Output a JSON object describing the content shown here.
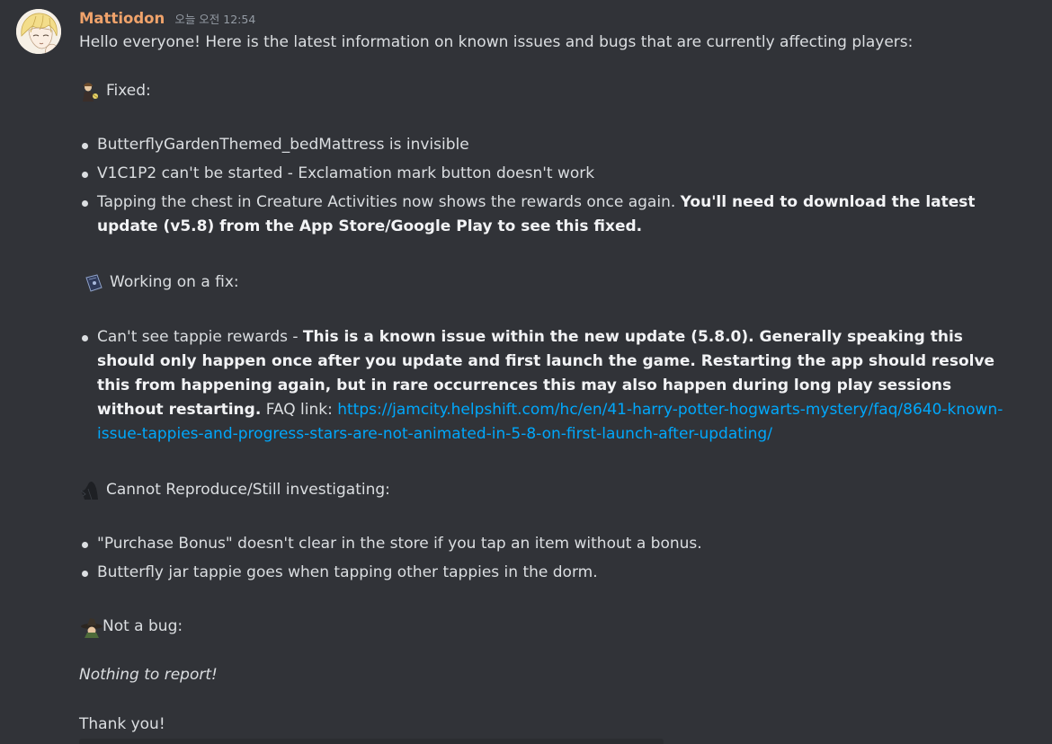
{
  "author": {
    "name": "Mattiodon",
    "timestamp": "오늘 오전 12:54"
  },
  "colors": {
    "background": "#313338",
    "username": "#f0a36b",
    "link": "#00a8fc",
    "text": "#dbdee1"
  },
  "intro": "Hello everyone! Here is the latest information on known issues and bugs that are currently affecting players:",
  "sections": {
    "fixed": {
      "icon": "wizard-emoji-icon",
      "title": "Fixed:",
      "items": [
        {
          "text": "ButterflyGardenThemed_bedMattress is invisible"
        },
        {
          "text": "V1C1P2 can't be started - Exclamation mark button doesn't work"
        },
        {
          "text": "Tapping the chest in Creature Activities now shows the rewards once again. ",
          "bold": "You'll need to download the latest update (v5.8) from the App Store/Google Play to see this fixed."
        }
      ]
    },
    "working": {
      "icon": "spellbook-emoji-icon",
      "title": "Working on a fix:",
      "items": [
        {
          "text": "Can't see tappie rewards - ",
          "bold": "This is a known issue within the new update (5.8.0). Generally speaking this should only happen once after you update and first launch the game. Restarting the app should resolve this from happening again, but in rare occurrences this may also happen during long play sessions without restarting.",
          "after": " FAQ link: ",
          "link": "https://jamcity.helpshift.com/hc/en/41-harry-potter-hogwarts-mystery/faq/8640-known-issue-tappies-and-progress-stars-are-not-animated-in-5-8-on-first-launch-after-updating/"
        }
      ]
    },
    "investigating": {
      "icon": "dementor-emoji-icon",
      "title": "Cannot Reproduce/Still investigating:",
      "items": [
        {
          "text": "\"Purchase Bonus\" doesn't clear in the store if you tap an item without a bonus."
        },
        {
          "text": "Butterfly jar tappie goes when tapping other tappies in the dorm."
        }
      ]
    },
    "notbug": {
      "icon": "witch-hat-emoji-icon",
      "title": "Not a bug:",
      "body": "Nothing to report!"
    }
  },
  "closing": "Thank you!"
}
